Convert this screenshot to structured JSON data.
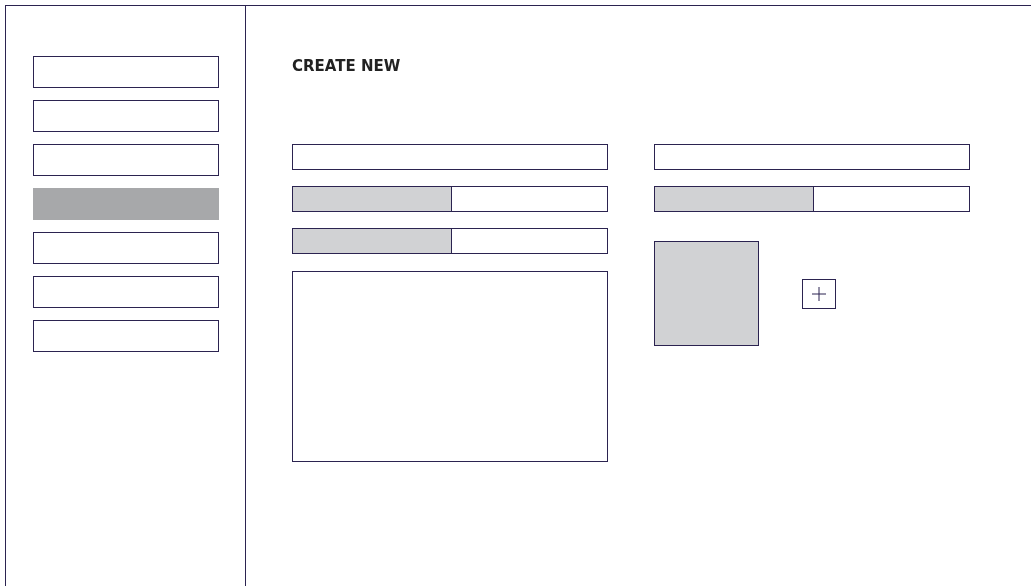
{
  "sidebar": {
    "items": [
      {
        "selected": false
      },
      {
        "selected": false
      },
      {
        "selected": false
      },
      {
        "selected": true
      },
      {
        "selected": false
      },
      {
        "selected": false
      },
      {
        "selected": false
      }
    ]
  },
  "title": "CREATE NEW",
  "form": {
    "left": [
      {
        "kind": "text"
      },
      {
        "kind": "split"
      },
      {
        "kind": "split"
      },
      {
        "kind": "textarea"
      }
    ],
    "right": [
      {
        "kind": "text"
      },
      {
        "kind": "split"
      },
      {
        "kind": "image_upload"
      }
    ]
  }
}
